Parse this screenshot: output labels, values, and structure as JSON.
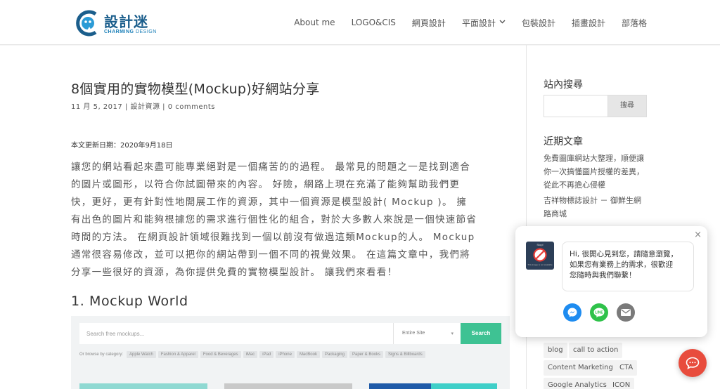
{
  "header": {
    "logo_name": "設計迷",
    "logo_sub_bold": "CHARMING",
    "logo_sub": "DESIGN",
    "nav": [
      {
        "label": "About me"
      },
      {
        "label": "LOGO&CIS"
      },
      {
        "label": "網頁設計"
      },
      {
        "label": "平面設計",
        "has_dropdown": true
      },
      {
        "label": "包裝設計"
      },
      {
        "label": "插畫設計"
      },
      {
        "label": "部落格"
      }
    ]
  },
  "post": {
    "title": "8個實用的實物模型(Mockup)好網站分享",
    "date": "11 月 5, 2017",
    "category": "設計資源",
    "comments": "0 comments",
    "updated": "本文更新日期：2020年9月18日",
    "body_lines": [
      "讓您的網站看起來盡可能專業絕對是一個痛苦的的過程。 最常見的問題之一是找到適合",
      "的圖片或圖形，以符合你試圖帶來的內容。 好險，網路上現在充滿了能夠幫助我們更",
      "快，更好，更有針對性地開展工作的資源，其中一個資源是模型設計( Mockup )。 擁",
      "有出色的圖片和能夠根據您的需求進行個性化的組合，對於大多數人來說是一個快速節省",
      "時間的方法。 在網頁設計領域很難找到一個以前沒有做過這類Mockup的人。 Mockup",
      "通常很容易修改，並可以把你的網站帶到一個不同的視覺效果。 在這篇文章中，我們將",
      "分享一些很好的資源，為你提供免費的實物模型設計。 讓我們來看看！"
    ],
    "section_heading": "1. Mockup World"
  },
  "screenshot": {
    "search_placeholder": "Search free mockups...",
    "select_value": "Entire Site",
    "search_button": "Search",
    "browse_label": "Or browse by category:",
    "categories": [
      "Apple Watch",
      "Fashion & Apparel",
      "Food & Beverages",
      "iMac",
      "iPad",
      "iPhone",
      "MacBook",
      "Packaging",
      "Paper & Books",
      "Signs & Billboards"
    ],
    "accent": "#3ec293"
  },
  "sidebar": {
    "search_heading": "站內搜尋",
    "search_button": "搜尋",
    "search_value": "",
    "recent_heading": "近期文章",
    "recent_posts": [
      {
        "lines": [
          "免費圖庫網站大整理，順便讓",
          "你一次搞懂圖片授權的差異，",
          "從此不再擔心侵權"
        ]
      },
      {
        "lines": [
          "吉祥物標誌設計 － 御鮮生網",
          "路商城"
        ]
      }
    ],
    "tags": [
      "blog",
      "call to action",
      "Content Marketing",
      "CTA",
      "Google Analytics",
      "ICON"
    ]
  },
  "chat": {
    "message_lines": [
      "Hi, 很開心見到您，請隨意瀏覽，",
      "如果您有業務上的需求，很歡迎",
      "您隨時與我們聯繫！"
    ],
    "avatar_top_text": "Stop!",
    "avatar_bottom_text": "This image is not available",
    "close_symbol": "×",
    "channels": [
      "messenger-icon",
      "line-icon",
      "email-icon"
    ],
    "colors": {
      "messenger": "#1e8cf0",
      "line": "#2fc24a",
      "email": "#7a7a7a",
      "fab": "#e84c3d"
    }
  }
}
